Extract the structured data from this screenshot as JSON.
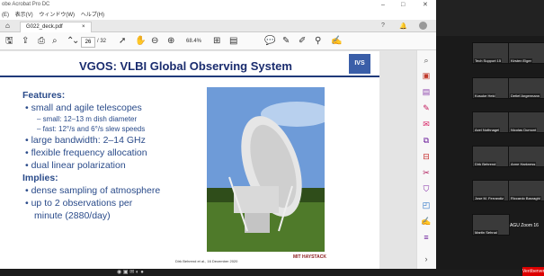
{
  "window": {
    "title": "obe Acrobat Pro DC"
  },
  "menu": [
    "(E)",
    "表示(V)",
    "ウィンドウ(W)",
    "ヘルプ(H)"
  ],
  "tab": {
    "label": "G022_deck.pdf",
    "close": "×"
  },
  "toolbar": {
    "page_current": "26",
    "page_total": "/ 32",
    "zoom": "68.4%"
  },
  "slide": {
    "title": "VGOS: VLBI Global Observing System",
    "logo": "IVS",
    "features_heading": "Features:",
    "bullets": [
      "small and agile telescopes",
      "large bandwidth: 2–14 GHz",
      "flexible frequency allocation",
      "dual linear polarization"
    ],
    "sub": [
      "small: 12–13 m dish diameter",
      "fast: 12°/s and 6°/s slew speeds"
    ],
    "implies_heading": "Implies:",
    "implies": [
      "dense sampling of atmosphere",
      "up to 2 observations per",
      "minute (2880/day)"
    ],
    "footer": "Dirk Behrend et al., 16 December 2020",
    "mit": "MIT HAYSTACK"
  },
  "participants": [
    "Tech Support 15",
    "Kirsten Elger",
    "Kosuke Heki",
    "Detlef Angermann",
    "Axel Nothnagel",
    "Nicolas Dumont",
    "Dirk Behrend",
    "Anne Harkness",
    "Jose M. Ferrandiz",
    "Riccardo Barzaghi",
    "Martin Sehnal",
    "AGU Zoom 16"
  ],
  "zoom_label": "AGU Zoom 16",
  "record_badge": "Veröbervers",
  "colors": {
    "title": "#1a2c6e",
    "bullet": "#2a4b8a",
    "accent": "#1f3a7a"
  }
}
